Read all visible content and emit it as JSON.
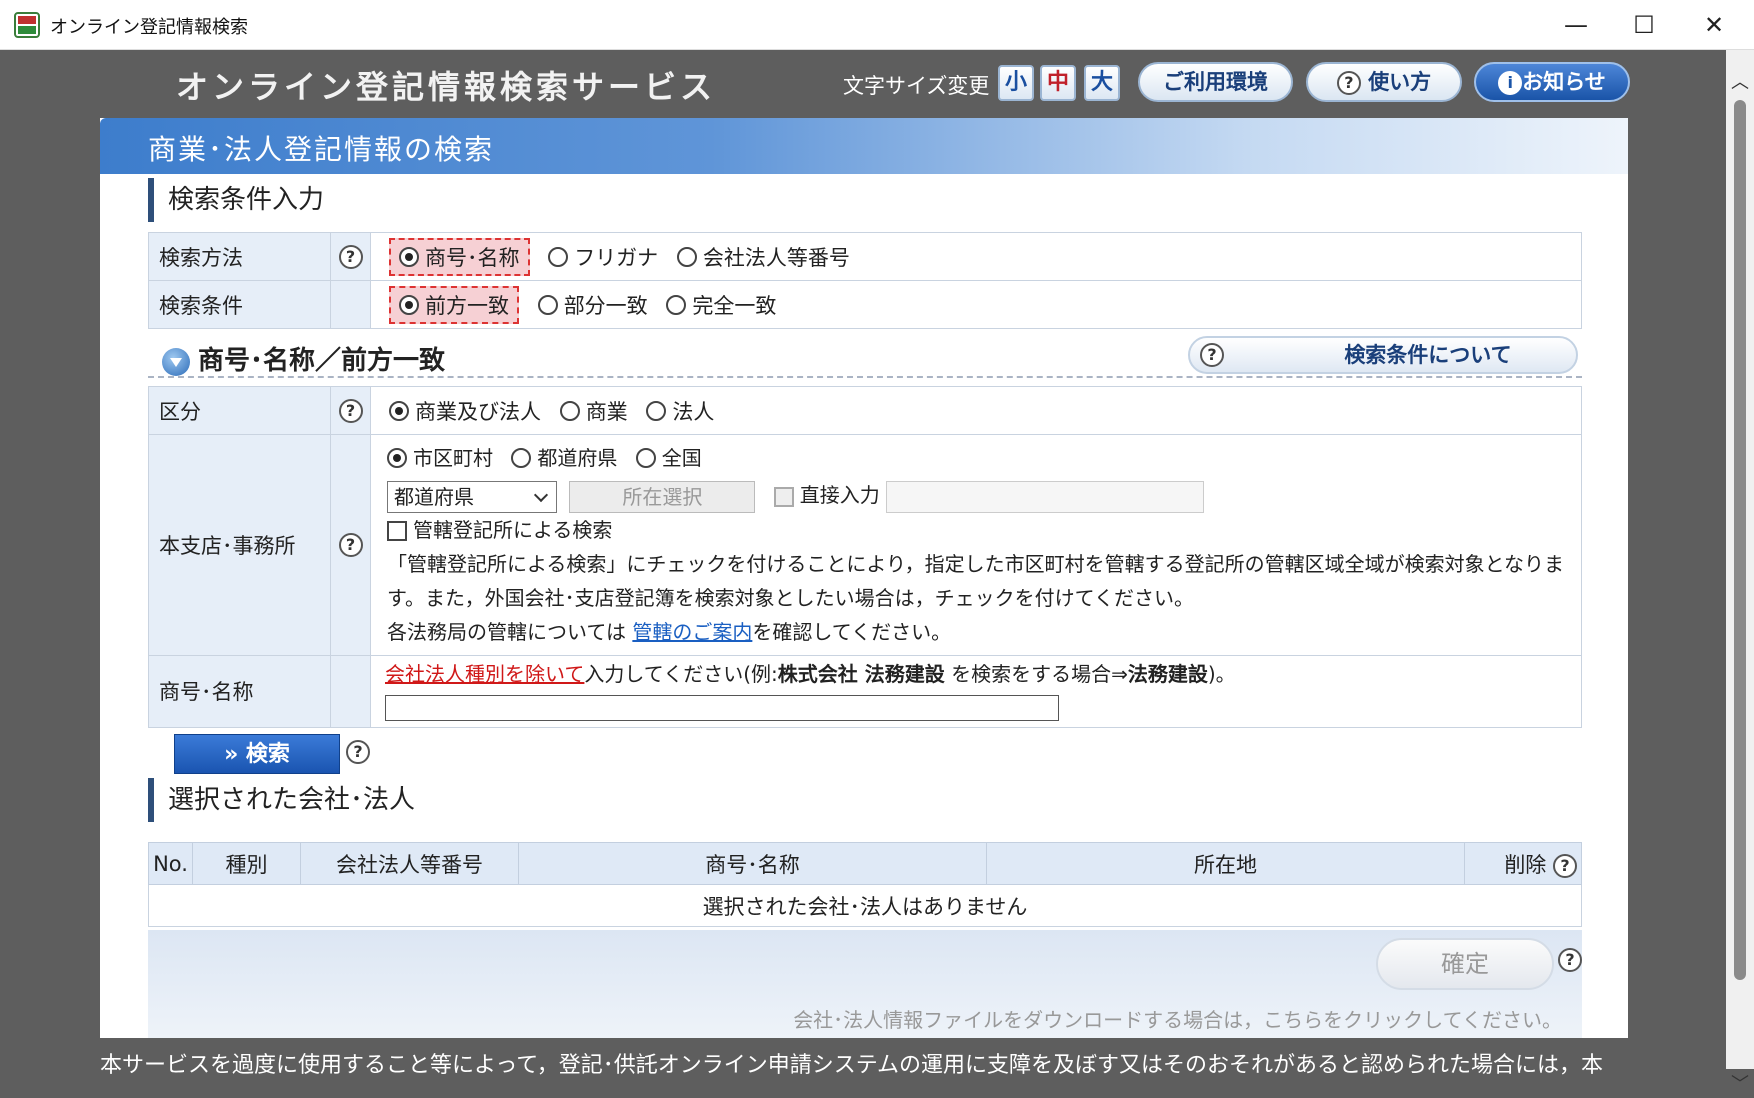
{
  "window": {
    "title": "オンライン登記情報検索",
    "min": "—",
    "max": "☐",
    "close": "✕"
  },
  "site_title": "オンライン登記情報検索サービス",
  "header": {
    "fontsize_label": "文字サイズ変更",
    "fs_small": "小",
    "fs_mid": "中",
    "fs_large": "大",
    "env": "ご利用環境",
    "usage": "使い方",
    "news": "お知らせ"
  },
  "banner_title": "商業･法人登記情報の検索",
  "section_condition": "検索条件入力",
  "method": {
    "label": "検索方法",
    "options": [
      "商号･名称",
      "フリガナ",
      "会社法人等番号"
    ]
  },
  "condition": {
    "label": "検索条件",
    "options": [
      "前方一致",
      "部分一致",
      "完全一致"
    ]
  },
  "subheading": "商号･名称／前方一致",
  "about_button": "検索条件について",
  "category": {
    "label": "区分",
    "options": [
      "商業及び法人",
      "商業",
      "法人"
    ]
  },
  "office": {
    "label": "本支店･事務所",
    "options": [
      "市区町村",
      "都道府県",
      "全国"
    ],
    "pref_select": "都道府県",
    "location_button": "所在選択",
    "direct_input": "直接入力",
    "jurisdiction_check": "管轄登記所による検索",
    "note1": "「管轄登記所による検索」にチェックを付けることにより，指定した市区町村を管轄する登記所の管轄区域全域が検索対象となりま",
    "note2": "す。また，外国会社･支店登記簿を検索対象としたい場合は，チェックを付けてください。",
    "note3_pre": "各法務局の管轄については ",
    "note3_link": "管轄のご案内",
    "note3_post": "を確認してください。"
  },
  "name": {
    "label": "商号･名称",
    "hint_link": "会社法人種別を除いて",
    "hint_mid": "入力してください(例:",
    "hint_ex1": "株式会社 法務建設",
    "hint_mid2": " を検索をする場合⇒",
    "hint_ex2": "法務建設",
    "hint_end": ")。",
    "value": ""
  },
  "search_button": "» 検索",
  "section_selected": "選択された会社･法人",
  "result_table": {
    "headers": [
      "No.",
      "種別",
      "会社法人等番号",
      "商号･名称",
      "所在地",
      "削除"
    ],
    "empty_message": "選択された会社･法人はありません"
  },
  "confirm_button": "確定",
  "download_note": "会社･法人情報ファイルをダウンロードする場合は，こちらをクリックしてください。",
  "bottom_text": "本サービスを過度に使用すること等によって，登記･供託オンライン申請システムの運用に支障を及ぼす又はそのおそれがあると認められた場合には，本",
  "help_glyph": "?",
  "info_glyph": "i",
  "colors": {
    "accent": "#1a54b0",
    "selected_bg": "#f6d0d4",
    "label_bg": "#e6eef8"
  }
}
